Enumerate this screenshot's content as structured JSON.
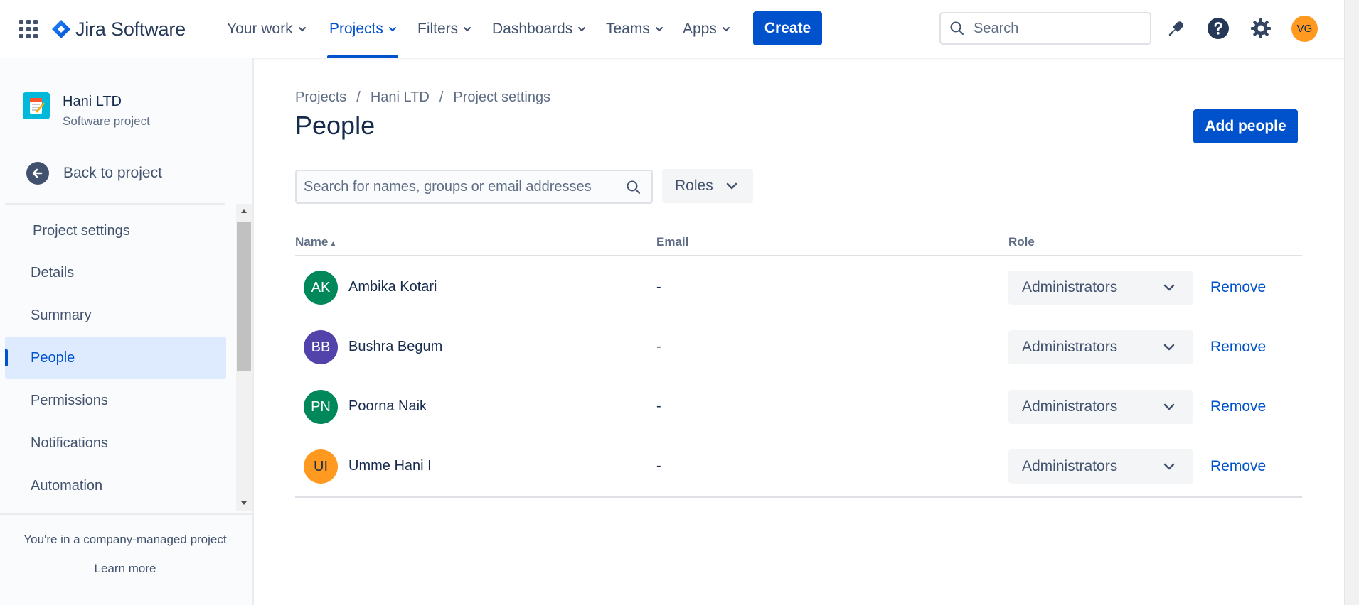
{
  "topnav": {
    "app_name": "Jira Software",
    "items": [
      {
        "label": "Your work"
      },
      {
        "label": "Projects"
      },
      {
        "label": "Filters"
      },
      {
        "label": "Dashboards"
      },
      {
        "label": "Teams"
      },
      {
        "label": "Apps"
      }
    ],
    "active_item": "Projects",
    "create_label": "Create",
    "search_placeholder": "Search",
    "icons": [
      "app-switcher-icon",
      "notifications-icon",
      "help-icon",
      "settings-icon"
    ],
    "user_initials": "VG"
  },
  "sidebar": {
    "project_name": "Hani LTD",
    "project_type": "Software project",
    "back_label": "Back to project",
    "section_title": "Project settings",
    "items": [
      {
        "label": "Details"
      },
      {
        "label": "Summary"
      },
      {
        "label": "People"
      },
      {
        "label": "Permissions"
      },
      {
        "label": "Notifications"
      },
      {
        "label": "Automation"
      }
    ],
    "selected_item": "People",
    "footer_note": "You're in a company-managed project",
    "learn_more": "Learn more"
  },
  "main": {
    "breadcrumb": [
      "Projects",
      "Hani LTD",
      "Project settings"
    ],
    "breadcrumb_separator": "/",
    "title": "People",
    "add_people_label": "Add people",
    "search_placeholder": "Search for names, groups or email addresses",
    "roles_filter_label": "Roles",
    "table": {
      "headers": {
        "name": "Name",
        "email": "Email",
        "role": "Role"
      },
      "sort_indicator": "ascending",
      "rows": [
        {
          "initials": "AK",
          "name": "Ambika Kotari",
          "email": "-",
          "role": "Administrators",
          "action": "Remove",
          "avatar_color": "#00875a"
        },
        {
          "initials": "BB",
          "name": "Bushra Begum",
          "email": "-",
          "role": "Administrators",
          "action": "Remove",
          "avatar_color": "#5243aa"
        },
        {
          "initials": "PN",
          "name": "Poorna Naik",
          "email": "-",
          "role": "Administrators",
          "action": "Remove",
          "avatar_color": "#00875a"
        },
        {
          "initials": "UI",
          "name": "Umme Hani I",
          "email": "-",
          "role": "Administrators",
          "action": "Remove",
          "avatar_color": "#ff991f"
        }
      ]
    }
  },
  "colors": {
    "brand_blue": "#0052cc",
    "text_primary": "#172b4d",
    "text_secondary": "#42526e"
  }
}
